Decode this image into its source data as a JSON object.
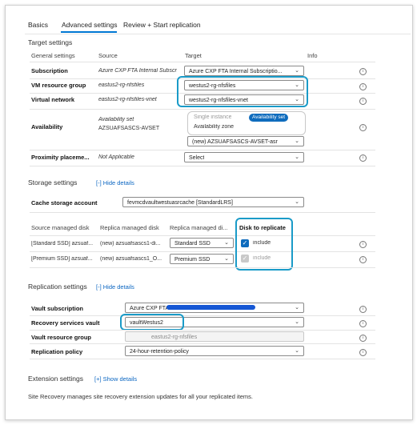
{
  "tabs": [
    "Basics",
    "Advanced settings",
    "Review + Start replication"
  ],
  "target_settings": {
    "title": "Target settings",
    "headers": [
      "General settings",
      "Source",
      "Target",
      "Info"
    ],
    "rows": {
      "subscription": {
        "label": "Subscription",
        "source": "Azure CXP FTA Internal Subscri...",
        "target": "Azure CXP FTA Internal Subscriptio..."
      },
      "vm_resource_group": {
        "label": "VM resource group",
        "source": "eastus2-rg-nfsfiles",
        "target": "westus2-rg-nfsfiles"
      },
      "virtual_network": {
        "label": "Virtual network",
        "source": "eastus2-rg-nfsfiles-vnet",
        "target": "westus2-rg-nfsfiles-vnet"
      },
      "availability": {
        "label": "Availability",
        "source_line1": "Availability set",
        "source_line2": "AZSUAFSASCS-AVSET",
        "options": [
          "Single instance",
          "Availability set",
          "Availability zone"
        ],
        "selected_option": "Availability set",
        "target": "(new) AZSUAFSASCS-AVSET-asr"
      },
      "proximity": {
        "label": "Proximity placeme...",
        "source": "Not Applicable",
        "target": "Select"
      }
    }
  },
  "storage_settings": {
    "title": "Storage settings",
    "hide_link": "[-] Hide details",
    "cache_label": "Cache storage account",
    "cache_value": "fevmcdvaultwestuasrcache [StandardLRS]",
    "headers": [
      "Source managed disk",
      "Replica managed disk",
      "Replica managed di...",
      "Disk to replicate"
    ],
    "disks": [
      {
        "source": "[Standard SSD] azsuaf...",
        "replica": "(new) azsuafsascs1-di...",
        "type": "Standard SSD",
        "replicate_label": "include",
        "checked": true
      },
      {
        "source": "[Premium SSD] azsuaf...",
        "replica": "(new) azsuafsascs1_O...",
        "type": "Premium SSD",
        "replicate_label": "include",
        "checked": true
      }
    ]
  },
  "replication_settings": {
    "title": "Replication settings",
    "hide_link": "[-] Hide details",
    "rows": {
      "vault_subscription": {
        "label": "Vault subscription",
        "value": "Azure CXP FTA"
      },
      "recovery_vault": {
        "label": "Recovery services vault",
        "value": "vaultWestus2"
      },
      "vault_rg": {
        "label": "Vault resource group",
        "value": "eastus2-rg-nfsfiles"
      },
      "policy": {
        "label": "Replication policy",
        "value": "24-hour-retention-policy"
      }
    }
  },
  "extension_settings": {
    "title": "Extension settings",
    "show_link": "[+] Show details",
    "note": "Site Recovery manages site recovery extension updates for all your replicated items."
  },
  "colors": {
    "accent": "#0078d4",
    "highlight": "#1a9bc8",
    "redaction": "#1557d4",
    "link": "#0b66c2"
  }
}
